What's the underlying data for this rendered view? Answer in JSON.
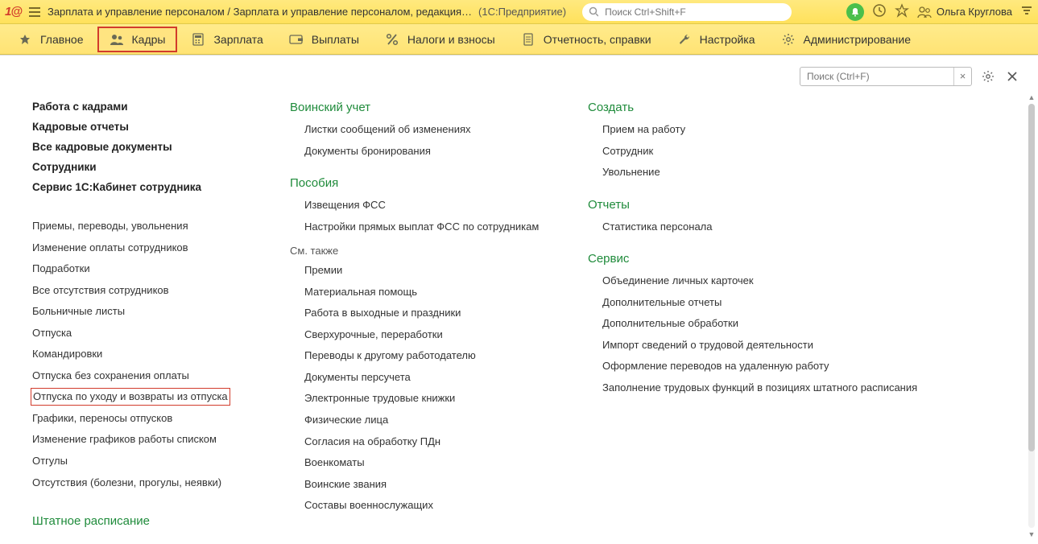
{
  "title": "Зарплата и управление персоналом / Зарплата и управление персоналом, редакция…",
  "title_suffix": "(1С:Предприятие)",
  "global_search_placeholder": "Поиск Ctrl+Shift+F",
  "user_name": "Ольга Круглова",
  "menubar": [
    {
      "label": "Главное",
      "icon": "star"
    },
    {
      "label": "Кадры",
      "icon": "people",
      "active": true
    },
    {
      "label": "Зарплата",
      "icon": "calc"
    },
    {
      "label": "Выплаты",
      "icon": "wallet"
    },
    {
      "label": "Налоги и взносы",
      "icon": "percent"
    },
    {
      "label": "Отчетность, справки",
      "icon": "doc"
    },
    {
      "label": "Настройка",
      "icon": "wrench"
    },
    {
      "label": "Администрирование",
      "icon": "gear"
    }
  ],
  "panel_search_placeholder": "Поиск (Ctrl+F)",
  "col1": {
    "bold": [
      "Работа с кадрами",
      "Кадровые отчеты",
      "Все кадровые документы",
      "Сотрудники",
      "Сервис 1С:Кабинет сотрудника"
    ],
    "links": [
      "Приемы, переводы, увольнения",
      "Изменение оплаты сотрудников",
      "Подработки",
      "Все отсутствия сотрудников",
      "Больничные листы",
      "Отпуска",
      "Командировки",
      "Отпуска без сохранения оплаты",
      "Отпуска по уходу и возвраты из отпуска",
      "Графики, переносы отпусков",
      "Изменение графиков работы списком",
      "Отгулы",
      "Отсутствия (болезни, прогулы, неявки)"
    ],
    "links_boxed_index": 8,
    "footer_head": "Штатное расписание"
  },
  "col2": {
    "g1_head": "Воинский учет",
    "g1_links": [
      "Листки сообщений об изменениях",
      "Документы бронирования"
    ],
    "g2_head": "Пособия",
    "g2_links": [
      "Извещения ФСС",
      "Настройки прямых выплат ФСС по сотрудникам"
    ],
    "sub_head": "См. также",
    "sub_links": [
      "Премии",
      "Материальная помощь",
      "Работа в выходные и праздники",
      "Сверхурочные, переработки",
      "Переводы к другому работодателю",
      "Документы персучета",
      "Электронные трудовые книжки",
      "Физические лица",
      "Согласия на обработку ПДн",
      "Военкоматы",
      "Воинские звания",
      "Составы военнослужащих"
    ]
  },
  "col3": {
    "g1_head": "Создать",
    "g1_links": [
      "Прием на работу",
      "Сотрудник",
      "Увольнение"
    ],
    "g2_head": "Отчеты",
    "g2_links": [
      "Статистика персонала"
    ],
    "g3_head": "Сервис",
    "g3_links": [
      "Объединение личных карточек",
      "Дополнительные отчеты",
      "Дополнительные обработки",
      "Импорт сведений о трудовой деятельности",
      "Оформление переводов на удаленную работу",
      "Заполнение трудовых функций в позициях штатного расписания"
    ]
  }
}
